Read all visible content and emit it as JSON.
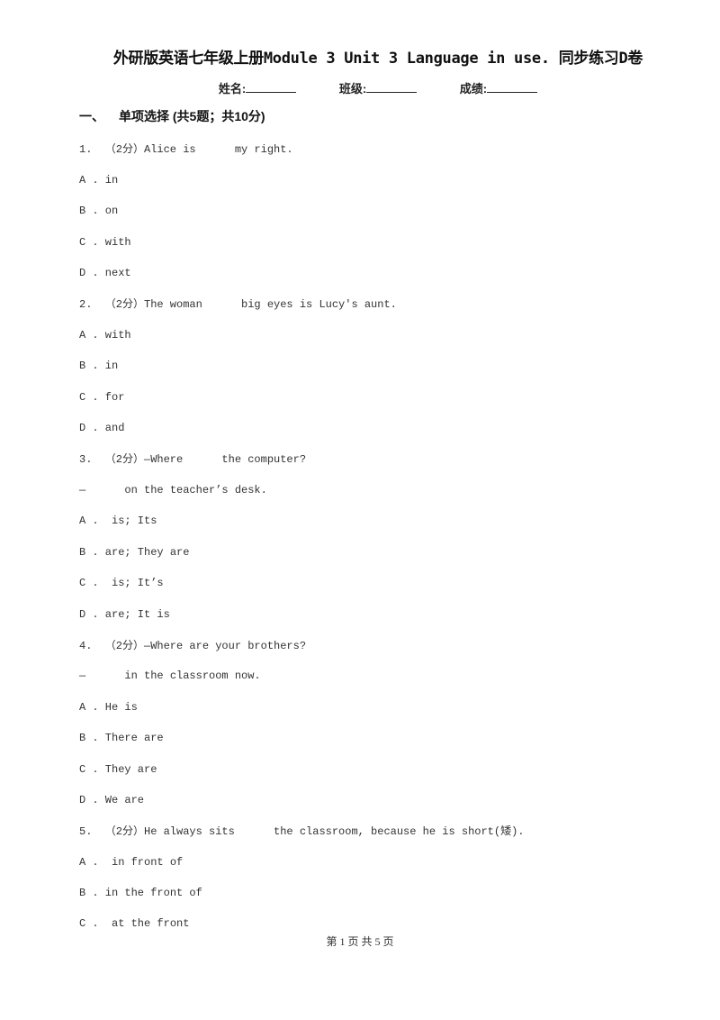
{
  "document": {
    "title": "外研版英语七年级上册Module 3 Unit 3 Language in use. 同步练习D卷",
    "info_fields": [
      {
        "label": "姓名:",
        "value": ""
      },
      {
        "label": "班级:",
        "value": ""
      },
      {
        "label": "成绩:",
        "value": ""
      }
    ],
    "section": {
      "number": "一、",
      "heading": "单项选择 (共5题；共10分)"
    },
    "questions": [
      {
        "stem": "1.  （2分）Alice is      my right.",
        "options": [
          "A . in",
          "B . on",
          "C . with",
          "D . next"
        ]
      },
      {
        "stem": "2.  （2分）The woman      big eyes is Lucy's aunt.",
        "options": [
          "A . with",
          "B . in",
          "C . for",
          "D . and"
        ]
      },
      {
        "stem": "3.  （2分）—Where      the computer?",
        "stem2": "—      on the teacher’s desk.",
        "options": [
          "A .  is; Its",
          "B . are; They are",
          "C .  is; It’s",
          "D . are; It is"
        ]
      },
      {
        "stem": "4.  （2分）—Where are your brothers?",
        "stem2": "—      in the classroom now.",
        "options": [
          "A . He is",
          "B . There are",
          "C . They are",
          "D . We are"
        ]
      },
      {
        "stem": "5.  （2分）He always sits      the classroom, because he is short(矮).",
        "options": [
          "A .  in front of",
          "B . in the front of",
          "C .  at the front"
        ]
      }
    ],
    "footer": "第 1 页 共 5 页"
  }
}
